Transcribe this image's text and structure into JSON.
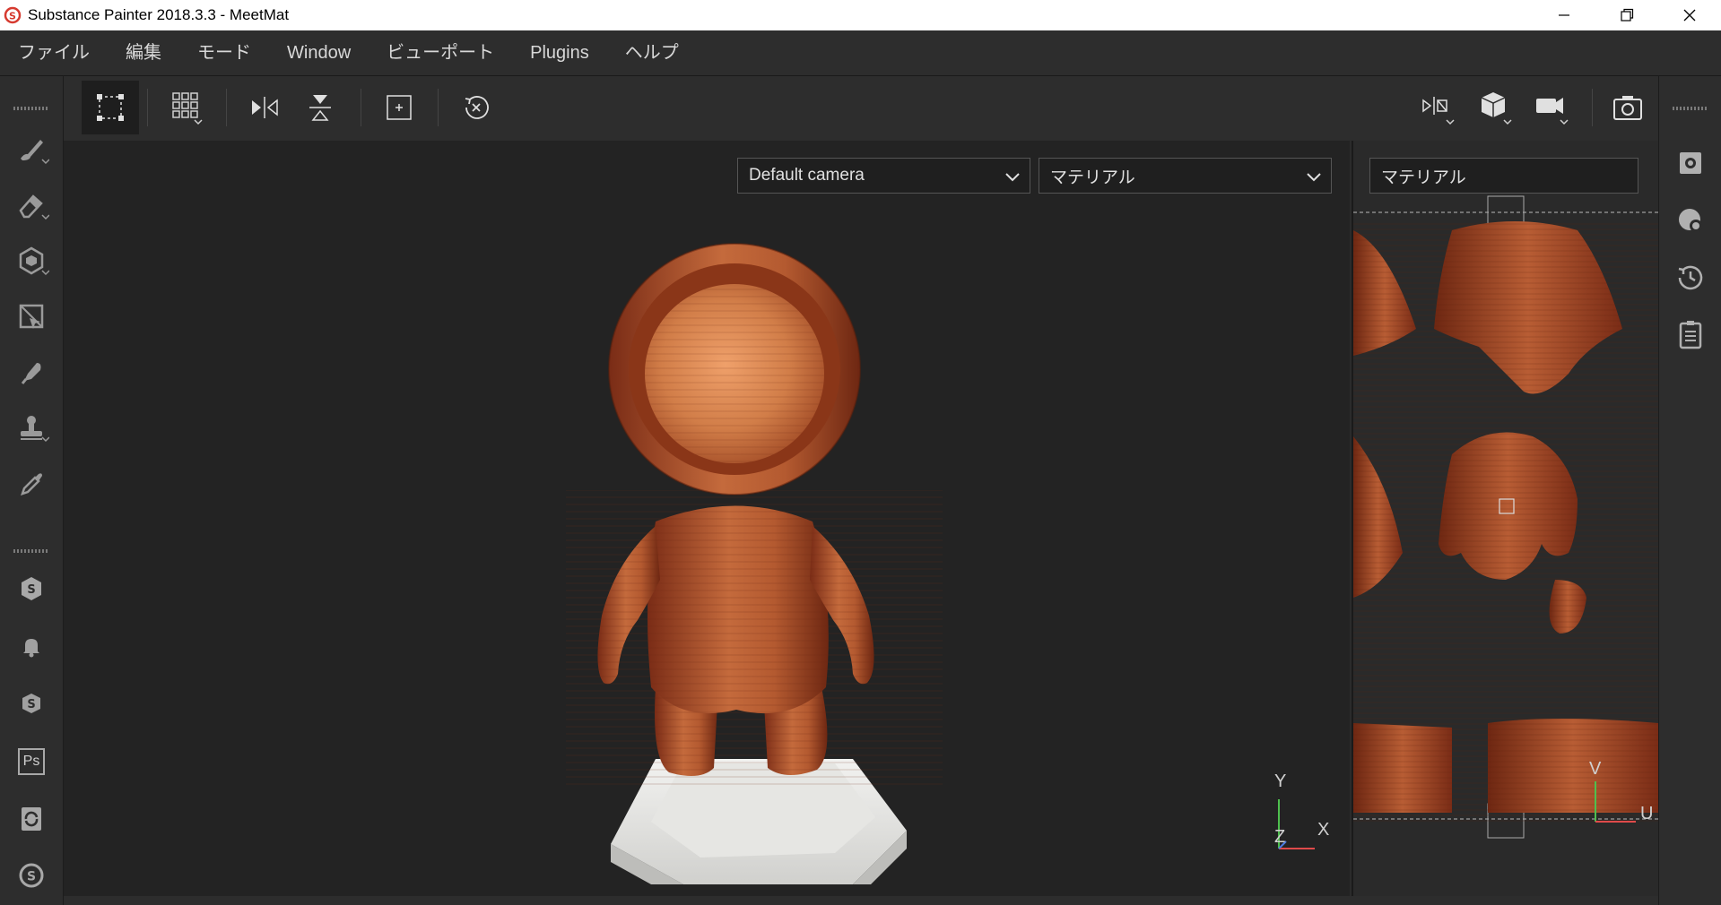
{
  "window": {
    "title": "Substance Painter 2018.3.3 - MeetMat",
    "controls": [
      "minimize-icon",
      "restore-icon",
      "close-icon"
    ]
  },
  "menubar": {
    "items": [
      "ファイル",
      "編集",
      "モード",
      "Window",
      "ビューポート",
      "Plugins",
      "ヘルプ"
    ]
  },
  "left_tools": [
    "paint-brush-icon",
    "eraser-icon",
    "projection-icon",
    "polygon-fill-icon",
    "smudge-icon",
    "clone-stamp-icon",
    "color-picker-icon",
    "substance-share-icon",
    "notification-icon",
    "substance-source-icon",
    "photoshop-icon",
    "sync-icon",
    "substance-logo-icon"
  ],
  "left_tools_labels": {
    "photoshop": "Ps"
  },
  "toolbar": {
    "left": [
      "frame-select-icon",
      "grid-view-icon",
      "symmetry-x-icon",
      "symmetry-y-icon",
      "fit-center-icon",
      "reset-icon"
    ],
    "right": [
      "split-view-icon",
      "cube-view-icon",
      "camera-icon",
      "screenshot-icon"
    ]
  },
  "right_panels": [
    "settings-icon",
    "environment-icon",
    "history-icon",
    "log-icon"
  ],
  "viewport3d": {
    "camera_select": "Default camera",
    "channel_select": "マテリアル",
    "axes": {
      "y": "Y",
      "z": "Z",
      "x": "X"
    }
  },
  "viewport2d": {
    "channel_select": "マテリアル",
    "axes": {
      "v": "V",
      "u": "U"
    }
  },
  "colors": {
    "wood_light": "#d88a52",
    "wood_dark": "#7a2c16",
    "viewport_bg": "#232323",
    "panel_bg": "#2d2d2d",
    "accent_red": "#c0392b"
  }
}
